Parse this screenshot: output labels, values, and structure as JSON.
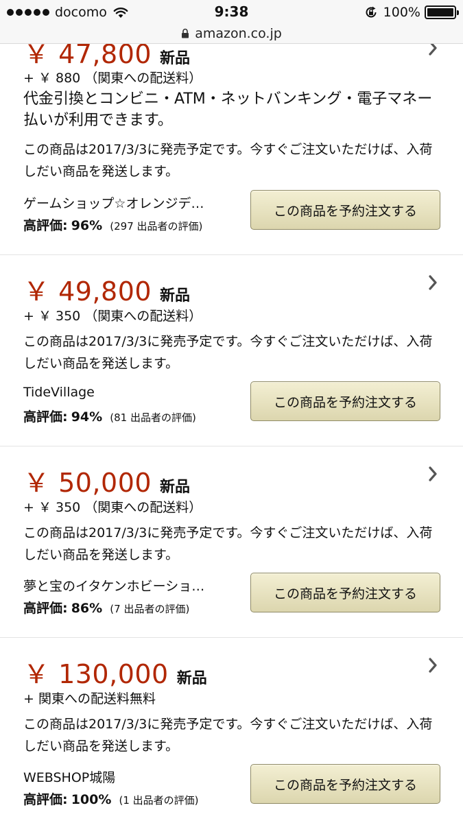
{
  "status_bar": {
    "carrier": "docomo",
    "time": "9:38",
    "battery": "100%",
    "signal_icon": "signal-dots-icon",
    "wifi_icon": "wifi-icon",
    "rotation_lock_icon": "rotation-lock-icon",
    "battery_icon": "battery-icon"
  },
  "url_bar": {
    "url": "amazon.co.jp",
    "lock_icon": "lock-icon"
  },
  "offers": [
    {
      "price": "￥ 47,800",
      "condition": "新品",
      "shipping": "+ ￥ 880 （関東への配送料）",
      "payment": "代金引換とコンビニ・ATM・ネットバンキング・電子マネー払いが利用できます。",
      "release": "この商品は2017/3/3に発売予定です。今すぐご注文いただけば、入荷しだい商品を発送します。",
      "seller": "ゲームショップ☆オレンジデ…",
      "rating_label": "高評価:",
      "rating_pct": "96%",
      "rating_count": "(297 出品者の評価)",
      "button": "この商品を予約注文する"
    },
    {
      "price": "￥ 49,800",
      "condition": "新品",
      "shipping": "+ ￥ 350 （関東への配送料）",
      "release": "この商品は2017/3/3に発売予定です。今すぐご注文いただけば、入荷しだい商品を発送します。",
      "seller": "TideVillage",
      "rating_label": "高評価:",
      "rating_pct": "94%",
      "rating_count": "(81 出品者の評価)",
      "button": "この商品を予約注文する"
    },
    {
      "price": "￥ 50,000",
      "condition": "新品",
      "shipping": "+ ￥ 350 （関東への配送料）",
      "release": "この商品は2017/3/3に発売予定です。今すぐご注文いただけば、入荷しだい商品を発送します。",
      "seller": "夢と宝のイタケンホビーショ…",
      "rating_label": "高評価:",
      "rating_pct": "86%",
      "rating_count": "(7 出品者の評価)",
      "button": "この商品を予約注文する"
    },
    {
      "price": "￥ 130,000",
      "condition": "新品",
      "shipping": "+ 関東への配送料無料",
      "release": "この商品は2017/3/3に発売予定です。今すぐご注文いただけば、入荷しだい商品を発送します。",
      "seller": "WEBSHOP城陽",
      "rating_label": "高評価:",
      "rating_pct": "100%",
      "rating_count": "(1 出品者の評価)",
      "button": "この商品を予約注文する"
    }
  ],
  "colors": {
    "price": "#b12704",
    "button_top": "#f3efd3",
    "button_bottom": "#dcd6ae"
  }
}
